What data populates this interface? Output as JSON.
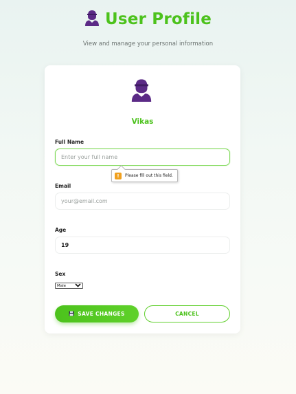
{
  "header": {
    "icon": "user-icon",
    "title": "User Profile",
    "subtitle": "View and manage your personal information"
  },
  "profile": {
    "avatar_icon": "user-avatar-icon",
    "username": "Vikas"
  },
  "form": {
    "full_name": {
      "label": "Full Name",
      "placeholder": "Enter your full name",
      "value": ""
    },
    "validation_message": "Please fill out this field.",
    "email": {
      "label": "Email",
      "placeholder": "your@email.com",
      "value": ""
    },
    "age": {
      "label": "Age",
      "value": "19"
    },
    "sex": {
      "label": "Sex",
      "selected": "Male"
    }
  },
  "actions": {
    "save_label": "SAVE CHANGES",
    "save_icon": "floppy-disk-icon",
    "cancel_label": "CANCEL"
  },
  "colors": {
    "accent": "#4cc21c",
    "icon_purple": "#5b2a86"
  }
}
